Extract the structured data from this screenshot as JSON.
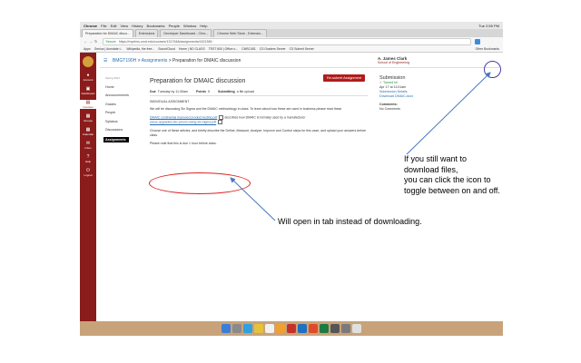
{
  "menubar": {
    "items": [
      "Chrome",
      "File",
      "Edit",
      "View",
      "History",
      "Bookmarks",
      "People",
      "Window",
      "Help"
    ],
    "right": "Tue 2:55 PM"
  },
  "tabs": [
    "Preparation for DMAIC discu...",
    "Extensions",
    "Developer Dashboard - Chro...",
    "Chrome Web Store - Extensio..."
  ],
  "url": {
    "secure": "Secure",
    "address": "https://myelms.umd.edu/courses/1317648/assignments/4321580"
  },
  "bookmarks": [
    "Apps",
    "Genius | Annotate t...",
    "Wikipedia, the free...",
    "SoundCloud",
    "Home | ND CLASS",
    "TEST 600 | Office o...",
    "CMSC451",
    "CS Graders Server",
    "CS Submit Server"
  ],
  "bookmarks_right": "Other Bookmarks",
  "leftnav": [
    {
      "icon": "●",
      "label": "Account"
    },
    {
      "icon": "▣",
      "label": "Dashboard"
    },
    {
      "icon": "▤",
      "label": "Courses"
    },
    {
      "icon": "▦",
      "label": "Groups"
    },
    {
      "icon": "▦",
      "label": "Calendar"
    },
    {
      "icon": "✉",
      "label": "Inbox"
    },
    {
      "icon": "?",
      "label": "Help"
    },
    {
      "icon": "⏻",
      "label": "Logout"
    }
  ],
  "breadcrumb": {
    "course": "BMGT190H",
    "section": "Assignments",
    "page": "Preparation for DMAIC discussion"
  },
  "brand": {
    "name": "A. James Clark",
    "sub": "School of Engineering"
  },
  "coursenav": {
    "term": "Spring 2017",
    "items": [
      "Home",
      "Announcements",
      "Grades",
      "People",
      "Syllabus",
      "Discussions",
      "Assignments"
    ]
  },
  "assignment": {
    "title": "Preparation for DMAIC discussion",
    "resubmit": "Re-submit Assignment",
    "due_label": "Due",
    "due_value": "Tuesday by 11:30am",
    "points_label": "Points",
    "points_value": "5",
    "submitting_label": "Submitting",
    "submitting_value": "a file upload",
    "heading": "INDIVIDUAL ASSIGNMENT",
    "intro": "We will be discussing Six Sigma and the DMAIC methodology in class. To learn about how these are used in business please read these",
    "link1": "DMAIC continental improved product testing.pdf",
    "link1_tail": "describes how DMAIC is formally used by a manufacturer",
    "link2": "mece-upgrades-dsc-pmom-using-six-sigma.pdf",
    "para2": "Choose one of these articles, and briefly describe the Define, Measure, Analyze, Improve and Control steps for this case, and upload your answers before class.",
    "para3": "Please note that this is due 1 hour before class."
  },
  "submission": {
    "heading": "Submission",
    "status": "Turned In!",
    "date": "Apr 17 at 11:01am",
    "details": "Submission Details",
    "download": "Download DMAIC.docx",
    "comments_label": "Comments:",
    "comments_value": "No Comments"
  },
  "annotations": {
    "right_note": [
      "If you still want to",
      "download files,",
      "you can click the icon to",
      "toggle between on and off."
    ],
    "bottom_note": "Will open in tab instead of downloading."
  },
  "colors": {
    "brand_red": "#8b1c1c",
    "resubmit_red": "#b01c1c",
    "link_blue": "#2a6fb0",
    "arrow_blue": "#4a78c0"
  }
}
